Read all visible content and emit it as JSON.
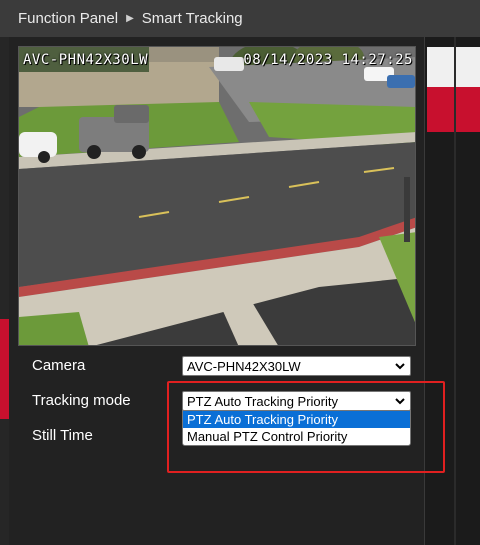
{
  "breadcrumb": {
    "parent": "Function Panel",
    "current": "Smart Tracking"
  },
  "video": {
    "camera_name_osd": "AVC-PHN42X30LW",
    "timestamp_osd": "08/14/2023 14:27:25"
  },
  "form": {
    "camera": {
      "label": "Camera",
      "value": "AVC-PHN42X30LW"
    },
    "tracking_mode": {
      "label": "Tracking mode",
      "value": "PTZ Auto Tracking Priority",
      "options": [
        "PTZ Auto Tracking Priority",
        "Manual PTZ Control Priority"
      ]
    },
    "still_time": {
      "label": "Still Time"
    }
  },
  "colors": {
    "accent_red": "#c8102e",
    "highlight_blue": "#0a6fd6",
    "annotation_red": "#e02020"
  }
}
